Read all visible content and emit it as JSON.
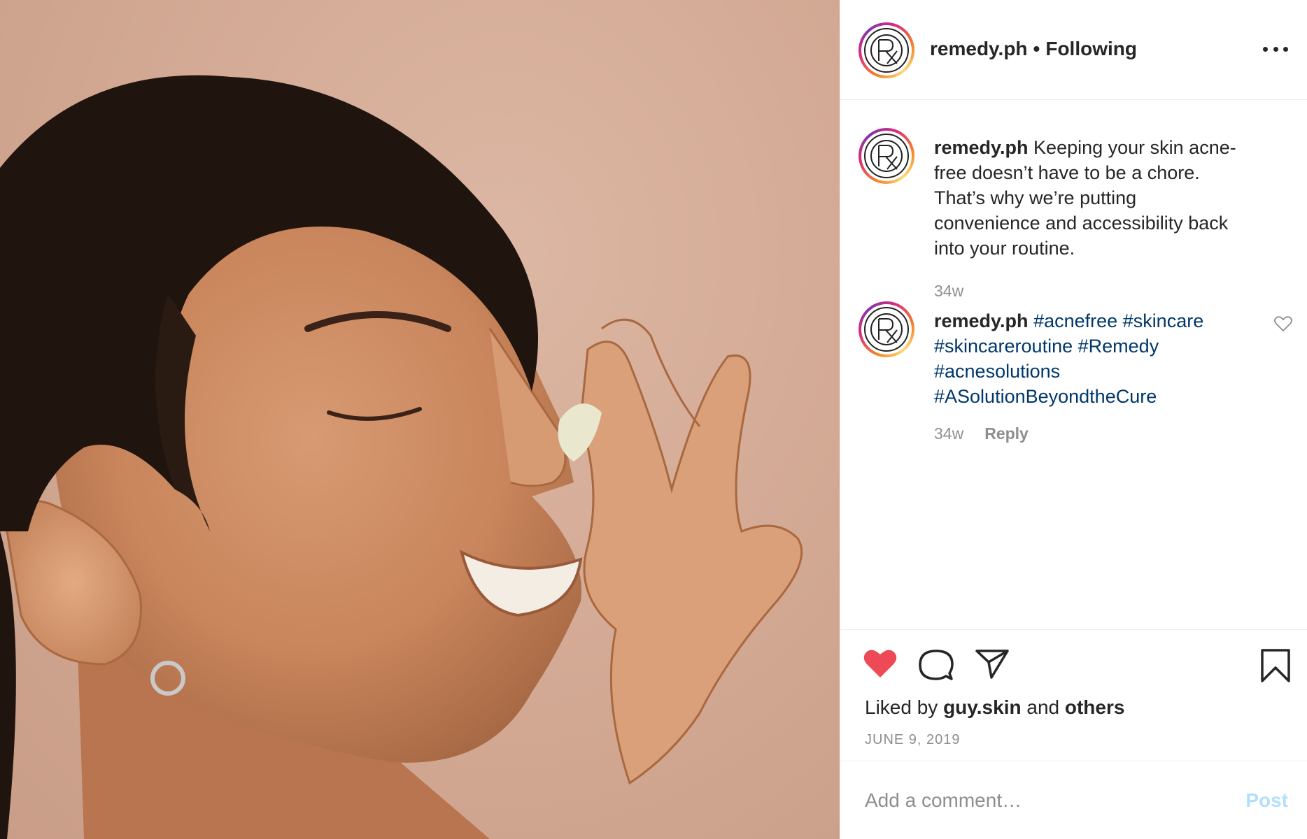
{
  "post": {
    "username": "remedy.ph",
    "separator": "•",
    "follow_status": "Following"
  },
  "comments": [
    {
      "username": "remedy.ph",
      "text": " Keeping your skin acne-free doesn’t have to be a chore. That’s why we’re putting convenience and accessibility back into your routine.",
      "age": "34w"
    },
    {
      "username": "remedy.ph",
      "hashtags": [
        "#acnefree",
        "#skincare",
        "#skincareroutine",
        "#Remedy",
        "#acnesolutions",
        "#ASolutionBeyondtheCure"
      ],
      "age": "34w",
      "reply_label": "Reply"
    }
  ],
  "likes": {
    "prefix": "Liked by ",
    "user": "guy.skin",
    "middle": " and ",
    "others": "others"
  },
  "date": "JUNE 9, 2019",
  "add_comment": {
    "placeholder": "Add a comment…",
    "post_label": "Post"
  },
  "colors": {
    "heart": "#ed4956",
    "hashtag": "#00376b",
    "post_button_disabled": "#b2dffc",
    "muted_text": "#8e8e8e"
  },
  "icons": [
    "heart-icon",
    "comment-icon",
    "share-icon",
    "bookmark-icon",
    "more-icon",
    "small-heart-icon"
  ]
}
